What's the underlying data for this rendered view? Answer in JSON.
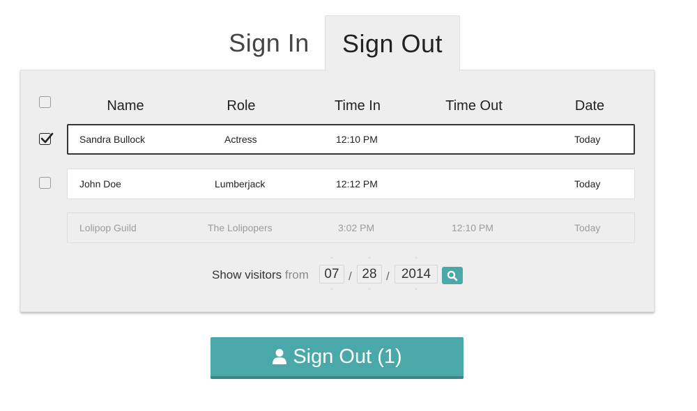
{
  "tabs": {
    "sign_in": "Sign In",
    "sign_out": "Sign Out",
    "active": "Sign Out"
  },
  "table": {
    "columns": [
      "Name",
      "Role",
      "Time In",
      "Time Out",
      "Date"
    ],
    "rows": [
      {
        "name": "Sandra Bullock",
        "role": "Actress",
        "time_in": "12:10 PM",
        "time_out": "",
        "date": "Today",
        "checked": true
      },
      {
        "name": "John Doe",
        "role": "Lumberjack",
        "time_in": "12:12 PM",
        "time_out": "",
        "date": "Today",
        "checked": false
      },
      {
        "name": "Lolipop Guild",
        "role": "The Lolipopers",
        "time_in": "3:02 PM",
        "time_out": "12:10 PM",
        "date": "Today",
        "checked": false
      }
    ]
  },
  "filter": {
    "label": "Show visitors",
    "from": "from",
    "month": "07",
    "day": "28",
    "year": "2014",
    "separator": "/"
  },
  "action": {
    "label": "Sign Out (1)"
  },
  "colors": {
    "accent": "#4aa8a8",
    "accent_dark": "#3a8787",
    "panel": "#eeeeee"
  },
  "icons": {
    "search": "search-icon",
    "user": "user-icon",
    "check": "check-icon",
    "spinner_up": "chevron-up-icon",
    "spinner_down": "chevron-down-icon"
  }
}
